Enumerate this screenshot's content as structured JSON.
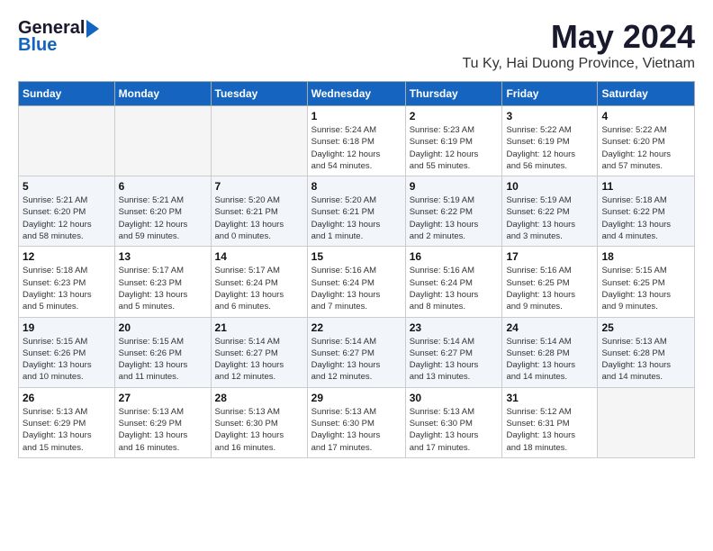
{
  "header": {
    "logo_general": "General",
    "logo_blue": "Blue",
    "month_year": "May 2024",
    "location": "Tu Ky, Hai Duong Province, Vietnam"
  },
  "weekdays": [
    "Sunday",
    "Monday",
    "Tuesday",
    "Wednesday",
    "Thursday",
    "Friday",
    "Saturday"
  ],
  "weeks": [
    [
      {
        "day": "",
        "info": ""
      },
      {
        "day": "",
        "info": ""
      },
      {
        "day": "",
        "info": ""
      },
      {
        "day": "1",
        "info": "Sunrise: 5:24 AM\nSunset: 6:18 PM\nDaylight: 12 hours\nand 54 minutes."
      },
      {
        "day": "2",
        "info": "Sunrise: 5:23 AM\nSunset: 6:19 PM\nDaylight: 12 hours\nand 55 minutes."
      },
      {
        "day": "3",
        "info": "Sunrise: 5:22 AM\nSunset: 6:19 PM\nDaylight: 12 hours\nand 56 minutes."
      },
      {
        "day": "4",
        "info": "Sunrise: 5:22 AM\nSunset: 6:20 PM\nDaylight: 12 hours\nand 57 minutes."
      }
    ],
    [
      {
        "day": "5",
        "info": "Sunrise: 5:21 AM\nSunset: 6:20 PM\nDaylight: 12 hours\nand 58 minutes."
      },
      {
        "day": "6",
        "info": "Sunrise: 5:21 AM\nSunset: 6:20 PM\nDaylight: 12 hours\nand 59 minutes."
      },
      {
        "day": "7",
        "info": "Sunrise: 5:20 AM\nSunset: 6:21 PM\nDaylight: 13 hours\nand 0 minutes."
      },
      {
        "day": "8",
        "info": "Sunrise: 5:20 AM\nSunset: 6:21 PM\nDaylight: 13 hours\nand 1 minute."
      },
      {
        "day": "9",
        "info": "Sunrise: 5:19 AM\nSunset: 6:22 PM\nDaylight: 13 hours\nand 2 minutes."
      },
      {
        "day": "10",
        "info": "Sunrise: 5:19 AM\nSunset: 6:22 PM\nDaylight: 13 hours\nand 3 minutes."
      },
      {
        "day": "11",
        "info": "Sunrise: 5:18 AM\nSunset: 6:22 PM\nDaylight: 13 hours\nand 4 minutes."
      }
    ],
    [
      {
        "day": "12",
        "info": "Sunrise: 5:18 AM\nSunset: 6:23 PM\nDaylight: 13 hours\nand 5 minutes."
      },
      {
        "day": "13",
        "info": "Sunrise: 5:17 AM\nSunset: 6:23 PM\nDaylight: 13 hours\nand 5 minutes."
      },
      {
        "day": "14",
        "info": "Sunrise: 5:17 AM\nSunset: 6:24 PM\nDaylight: 13 hours\nand 6 minutes."
      },
      {
        "day": "15",
        "info": "Sunrise: 5:16 AM\nSunset: 6:24 PM\nDaylight: 13 hours\nand 7 minutes."
      },
      {
        "day": "16",
        "info": "Sunrise: 5:16 AM\nSunset: 6:24 PM\nDaylight: 13 hours\nand 8 minutes."
      },
      {
        "day": "17",
        "info": "Sunrise: 5:16 AM\nSunset: 6:25 PM\nDaylight: 13 hours\nand 9 minutes."
      },
      {
        "day": "18",
        "info": "Sunrise: 5:15 AM\nSunset: 6:25 PM\nDaylight: 13 hours\nand 9 minutes."
      }
    ],
    [
      {
        "day": "19",
        "info": "Sunrise: 5:15 AM\nSunset: 6:26 PM\nDaylight: 13 hours\nand 10 minutes."
      },
      {
        "day": "20",
        "info": "Sunrise: 5:15 AM\nSunset: 6:26 PM\nDaylight: 13 hours\nand 11 minutes."
      },
      {
        "day": "21",
        "info": "Sunrise: 5:14 AM\nSunset: 6:27 PM\nDaylight: 13 hours\nand 12 minutes."
      },
      {
        "day": "22",
        "info": "Sunrise: 5:14 AM\nSunset: 6:27 PM\nDaylight: 13 hours\nand 12 minutes."
      },
      {
        "day": "23",
        "info": "Sunrise: 5:14 AM\nSunset: 6:27 PM\nDaylight: 13 hours\nand 13 minutes."
      },
      {
        "day": "24",
        "info": "Sunrise: 5:14 AM\nSunset: 6:28 PM\nDaylight: 13 hours\nand 14 minutes."
      },
      {
        "day": "25",
        "info": "Sunrise: 5:13 AM\nSunset: 6:28 PM\nDaylight: 13 hours\nand 14 minutes."
      }
    ],
    [
      {
        "day": "26",
        "info": "Sunrise: 5:13 AM\nSunset: 6:29 PM\nDaylight: 13 hours\nand 15 minutes."
      },
      {
        "day": "27",
        "info": "Sunrise: 5:13 AM\nSunset: 6:29 PM\nDaylight: 13 hours\nand 16 minutes."
      },
      {
        "day": "28",
        "info": "Sunrise: 5:13 AM\nSunset: 6:30 PM\nDaylight: 13 hours\nand 16 minutes."
      },
      {
        "day": "29",
        "info": "Sunrise: 5:13 AM\nSunset: 6:30 PM\nDaylight: 13 hours\nand 17 minutes."
      },
      {
        "day": "30",
        "info": "Sunrise: 5:13 AM\nSunset: 6:30 PM\nDaylight: 13 hours\nand 17 minutes."
      },
      {
        "day": "31",
        "info": "Sunrise: 5:12 AM\nSunset: 6:31 PM\nDaylight: 13 hours\nand 18 minutes."
      },
      {
        "day": "",
        "info": ""
      }
    ]
  ]
}
